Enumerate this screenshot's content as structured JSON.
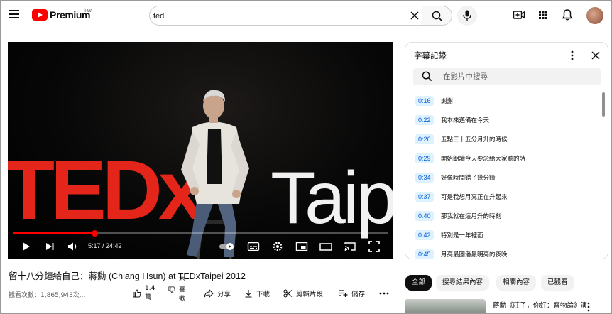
{
  "header": {
    "brand": "Premium",
    "region": "TW",
    "search_value": "ted"
  },
  "icons": {
    "menu": "hamburger-menu-icon",
    "search": "search-icon",
    "clear": "close-icon",
    "mic": "microphone-icon",
    "create": "create-video-icon",
    "apps": "apps-grid-icon",
    "notifications": "bell-icon"
  },
  "player": {
    "progress_fraction": 0.2167,
    "time": "5:17 / 24:42",
    "scene_text_left": "TEDx",
    "scene_text_right": "Taip"
  },
  "video": {
    "title": "留十八分鐘給自己：蔣勳 (Chiang Hsun) at TEDxTaipei 2012",
    "views": "觀看次數：1,865,943次...",
    "like_count_line1": "1.4",
    "like_count_line2": "萬",
    "dislike_line1": "不",
    "dislike_line2": "喜",
    "dislike_line3": "歡",
    "share": "分享",
    "download": "下載",
    "clip": "剪輯片段",
    "save": "儲存"
  },
  "transcript": {
    "title": "字幕記錄",
    "search_placeholder": "在影片中搜尋",
    "rows": [
      {
        "time": "0:16",
        "text": "謝謝"
      },
      {
        "time": "0:22",
        "text": "我本來邁備在今天"
      },
      {
        "time": "0:26",
        "text": "五點三十五分月升的時候"
      },
      {
        "time": "0:29",
        "text": "開始朗讀今天要念給大家聽的詩"
      },
      {
        "time": "0:34",
        "text": "好像時間錯了幾分鐘"
      },
      {
        "time": "0:37",
        "text": "可是我想月亮正在升起來"
      },
      {
        "time": "0:40",
        "text": "那我就在這月升的時刻"
      },
      {
        "time": "0:42",
        "text": "特別是一年裡面"
      },
      {
        "time": "0:45",
        "text": "月亮最圓潘最明亮的夜晚"
      }
    ]
  },
  "chips": [
    "全部",
    "搜尋結果內容",
    "相關內容",
    "已觀看"
  ],
  "related": {
    "title": "蔣勳《莊子，你好：齊物論》演"
  },
  "colors": {
    "brand_red": "#ff0000",
    "ted_red": "#e4261a",
    "timestamp_bg": "#def1ff",
    "timestamp_text": "#065fd4"
  }
}
